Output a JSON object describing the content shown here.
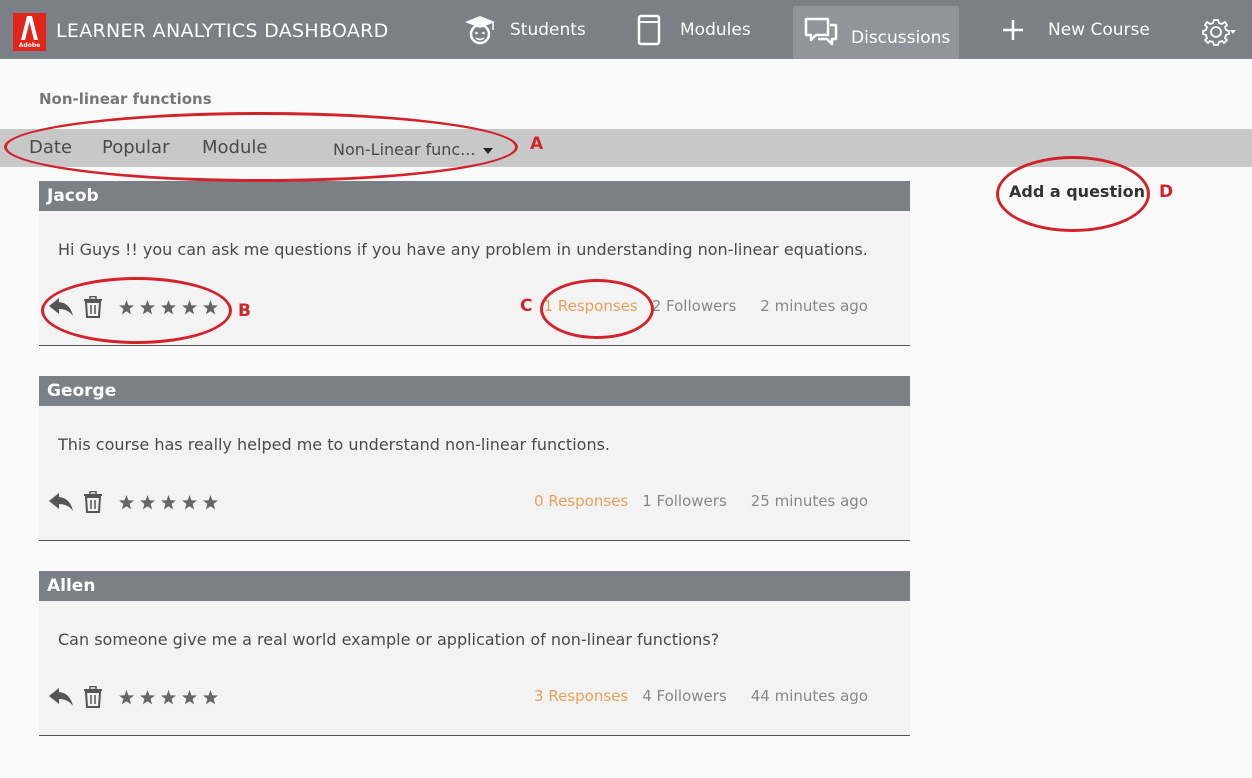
{
  "header": {
    "logo_text": "Adobe",
    "app_title": "LEARNER ANALYTICS DASHBOARD",
    "nav": [
      {
        "label": "Students",
        "icon": "student-icon"
      },
      {
        "label": "Modules",
        "icon": "book-icon"
      },
      {
        "label": "Discussions",
        "icon": "discussion-icon"
      },
      {
        "label": "New Course",
        "icon": "plus-icon"
      }
    ],
    "settings_icon": "gear-icon"
  },
  "page_title": "Non-linear functions",
  "filters": {
    "date": "Date",
    "popular": "Popular",
    "module": "Module",
    "selected_module": "Non-Linear func..."
  },
  "sidebar": {
    "add_question": "Add a question"
  },
  "posts": [
    {
      "author": "Jacob",
      "text": "Hi Guys !! you can ask me questions if you have any problem in understanding non-linear equations.",
      "responses": "1 Responses",
      "followers": "2 Followers",
      "time": "2 minutes ago",
      "rating": 5
    },
    {
      "author": "George",
      "text": "This course has really helped me to understand non-linear functions.",
      "responses": "0 Responses",
      "followers": "1 Followers",
      "time": "25 minutes ago",
      "rating": 5
    },
    {
      "author": "Allen",
      "text": "Can someone give me a real world example or application of non-linear functions?",
      "responses": "3 Responses",
      "followers": "4 Followers",
      "time": "44 minutes ago",
      "rating": 5
    }
  ],
  "annotations": {
    "a": "A",
    "b": "B",
    "c": "C",
    "d": "D"
  },
  "colors": {
    "topbar": "#7b7f86",
    "accent_orange": "#e8a05a",
    "annotation_red": "#d2232a"
  }
}
